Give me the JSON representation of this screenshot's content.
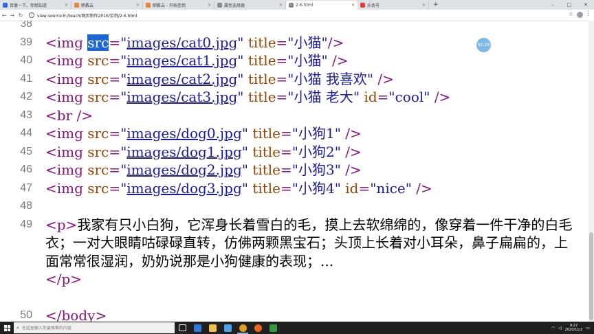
{
  "browser": {
    "tabs": [
      {
        "label": "百度一下，你就知道",
        "color": "#3068e4",
        "active": false
      },
      {
        "label": "职教云",
        "color": "#e8863a",
        "active": false
      },
      {
        "label": "职教云 - 开始签到",
        "color": "#e8863a",
        "active": false
      },
      {
        "label": "属性选择器",
        "color": "#8a8a8a",
        "active": false
      },
      {
        "label": "2-6.html",
        "color": "#8a8a8a",
        "active": true
      },
      {
        "label": "头条号",
        "color": "#e53935",
        "active": false
      }
    ],
    "new_tab": "+",
    "close_glyph": "×",
    "url": "view-source:E:/teach/网页制作2016/实例/2-6.html"
  },
  "source": {
    "lines": [
      {
        "num": "38",
        "segs": []
      },
      {
        "num": "39",
        "segs": [
          [
            "tag",
            "<img "
          ],
          [
            "sel",
            "src"
          ],
          [
            "tag",
            "="
          ],
          [
            "val",
            "\""
          ],
          [
            "link",
            "images/cat0.jpg"
          ],
          [
            "val",
            "\""
          ],
          [
            "attr",
            " title"
          ],
          [
            "tag",
            "="
          ],
          [
            "val",
            "\"小猫\""
          ],
          [
            "tag",
            "/>"
          ]
        ]
      },
      {
        "num": "40",
        "segs": [
          [
            "tag",
            "<img "
          ],
          [
            "attr",
            "src"
          ],
          [
            "tag",
            "="
          ],
          [
            "val",
            "\""
          ],
          [
            "link",
            "images/cat1.jpg"
          ],
          [
            "val",
            "\""
          ],
          [
            "attr",
            " title"
          ],
          [
            "tag",
            "="
          ],
          [
            "val",
            "\"小猫\""
          ],
          [
            "tag",
            " />"
          ]
        ]
      },
      {
        "num": "41",
        "segs": [
          [
            "tag",
            "<img "
          ],
          [
            "attr",
            "src"
          ],
          [
            "tag",
            "="
          ],
          [
            "val",
            "\""
          ],
          [
            "link",
            "images/cat2.jpg"
          ],
          [
            "val",
            "\""
          ],
          [
            "attr",
            " title"
          ],
          [
            "tag",
            "="
          ],
          [
            "val",
            "\"小猫 我喜欢\""
          ],
          [
            "tag",
            " />"
          ]
        ]
      },
      {
        "num": "42",
        "segs": [
          [
            "tag",
            "<img "
          ],
          [
            "attr",
            "src"
          ],
          [
            "tag",
            "="
          ],
          [
            "val",
            "\""
          ],
          [
            "link",
            "images/cat3.jpg"
          ],
          [
            "val",
            "\""
          ],
          [
            "attr",
            " title"
          ],
          [
            "tag",
            "="
          ],
          [
            "val",
            "\"小猫 老大\""
          ],
          [
            "attr",
            " id"
          ],
          [
            "tag",
            "="
          ],
          [
            "val",
            "\"cool\""
          ],
          [
            "tag",
            " />"
          ]
        ]
      },
      {
        "num": "43",
        "segs": [
          [
            "tag",
            "<br />"
          ]
        ]
      },
      {
        "num": "44",
        "segs": [
          [
            "tag",
            "<img "
          ],
          [
            "attr",
            "src"
          ],
          [
            "tag",
            "="
          ],
          [
            "val",
            "\""
          ],
          [
            "link",
            "images/dog0.jpg"
          ],
          [
            "val",
            "\""
          ],
          [
            "attr",
            " title"
          ],
          [
            "tag",
            "="
          ],
          [
            "val",
            "\"小狗1\""
          ],
          [
            "tag",
            " />"
          ]
        ]
      },
      {
        "num": "45",
        "segs": [
          [
            "tag",
            "<img "
          ],
          [
            "attr",
            "src"
          ],
          [
            "tag",
            "="
          ],
          [
            "val",
            "\""
          ],
          [
            "link",
            "images/dog1.jpg"
          ],
          [
            "val",
            "\""
          ],
          [
            "attr",
            " title"
          ],
          [
            "tag",
            "="
          ],
          [
            "val",
            "\"小狗2\""
          ],
          [
            "tag",
            " />"
          ]
        ]
      },
      {
        "num": "46",
        "segs": [
          [
            "tag",
            "<img "
          ],
          [
            "attr",
            "src"
          ],
          [
            "tag",
            "="
          ],
          [
            "val",
            "\""
          ],
          [
            "link",
            "images/dog2.jpg"
          ],
          [
            "val",
            "\""
          ],
          [
            "attr",
            " title"
          ],
          [
            "tag",
            "="
          ],
          [
            "val",
            "\"小狗3\""
          ],
          [
            "tag",
            " />"
          ]
        ]
      },
      {
        "num": "47",
        "segs": [
          [
            "tag",
            "<img "
          ],
          [
            "attr",
            "src"
          ],
          [
            "tag",
            "="
          ],
          [
            "val",
            "\""
          ],
          [
            "link",
            "images/dog3.jpg"
          ],
          [
            "val",
            "\""
          ],
          [
            "attr",
            " title"
          ],
          [
            "tag",
            "="
          ],
          [
            "val",
            "\"小狗4\""
          ],
          [
            "attr",
            " id"
          ],
          [
            "tag",
            "="
          ],
          [
            "val",
            "\"nice\""
          ],
          [
            "tag",
            " />"
          ]
        ]
      },
      {
        "num": "48",
        "segs": []
      }
    ],
    "para_num": "49",
    "para_open": "<p>",
    "para_text": "我家有只小白狗，它浑身长着雪白的毛，摸上去软绵绵的，像穿着一件干净的白毛衣；一对大眼睛咕碌碌直转，仿佛两颗黑宝石；头顶上长着对小耳朵，鼻子扁扁的，上面常常很湿润，奶奶说那是小狗健康的表现；...",
    "para_close": "</p>",
    "after": [
      {
        "num": "50",
        "text": "</body>"
      },
      {
        "num": "51",
        "text": "</html>"
      }
    ]
  },
  "badge": "01:28",
  "taskbar": {
    "search_placeholder": "在这里输入你要搜索的内容",
    "apps": [
      {
        "name": "task-view-icon",
        "color": "#ffffff"
      },
      {
        "name": "edge-icon",
        "color": "#2f7bd6"
      },
      {
        "name": "file-explorer-icon",
        "color": "#f2c04a"
      },
      {
        "name": "ie-icon",
        "color": "#4aa3e8"
      },
      {
        "name": "chrome-icon",
        "color": "#e0a020"
      },
      {
        "name": "firefox-icon",
        "color": "#e56a1f"
      },
      {
        "name": "terminal-icon",
        "color": "#3a9a3a"
      }
    ],
    "time": "9:27",
    "date": "2020/11/2"
  }
}
